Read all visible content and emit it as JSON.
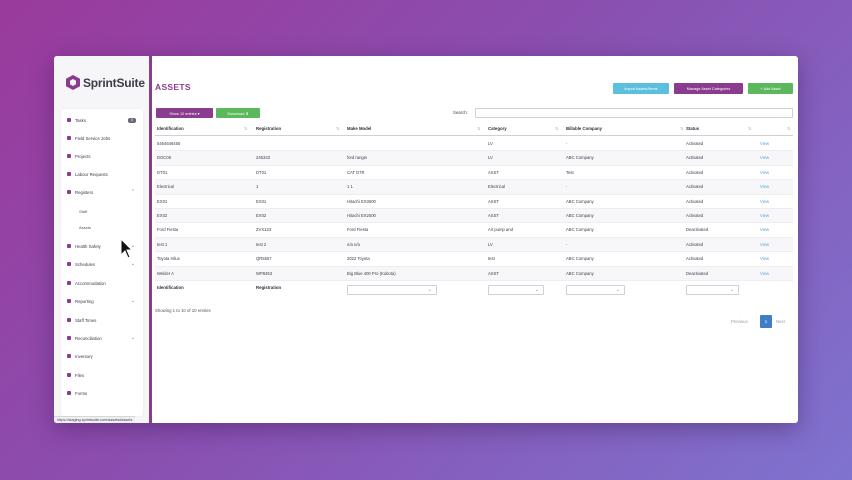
{
  "app": {
    "logo_text": "SprintSuite",
    "page_title": "ASSETS",
    "accent": "#8b3c8f"
  },
  "sidebar": {
    "items": [
      {
        "label": "Tasks",
        "icon": "tasks-icon",
        "badge": "0"
      },
      {
        "label": "Field Service Jobs",
        "icon": "wrench-icon"
      },
      {
        "label": "Projects",
        "icon": "projects-icon"
      },
      {
        "label": "Labour Requests",
        "icon": "person-icon"
      },
      {
        "label": "Registers",
        "icon": "registers-icon",
        "expanded": true
      },
      {
        "label": "Staff",
        "sub": true
      },
      {
        "label": "Assets",
        "sub": true
      },
      {
        "label": "Health Safety",
        "icon": "health-icon"
      },
      {
        "label": "Schedules",
        "icon": "calendar-icon"
      },
      {
        "label": "Accommodation",
        "icon": "bed-icon"
      },
      {
        "label": "Reporting",
        "icon": "chart-icon"
      },
      {
        "label": "Staff Times",
        "icon": "clock-icon"
      },
      {
        "label": "Reconciliation",
        "icon": "reconcile-icon"
      },
      {
        "label": "Inventory",
        "icon": "inventory-icon"
      },
      {
        "label": "Files",
        "icon": "folder-icon"
      },
      {
        "label": "Forms",
        "icon": "form-icon"
      }
    ]
  },
  "status_url": "https://staging.sprintsuite.com/assets#assets",
  "toolbar": {
    "import_label": "Import Assets/Items",
    "categories_label": "Manage Asset Categories",
    "add_label": "+ Add Asset",
    "show_entries_label": "Show 10 entries ▾",
    "download_label": "Download ⬇",
    "search_label": "Search:",
    "search_value": ""
  },
  "table": {
    "columns": [
      "Identification",
      "Registration",
      "Make Model",
      "Category",
      "Billable Company",
      "Status"
    ],
    "rows": [
      [
        "5454646455",
        "",
        "",
        "LV",
        "-",
        "Activated",
        "View"
      ],
      [
        "DOC08",
        "245343",
        "ford ranger",
        "LV",
        "ABC Company",
        "Activated",
        "View"
      ],
      [
        "DT01",
        "DT01",
        "CAT D7R",
        "ASST",
        "Test",
        "Activated",
        "View"
      ],
      [
        "Electrical",
        "1",
        "1 1",
        "Electrical",
        "-",
        "Activated",
        "View"
      ],
      [
        "EX01",
        "EX01",
        "Hitachi EX3600",
        "ASST",
        "ABC Company",
        "Activated",
        "View"
      ],
      [
        "EX02",
        "EX02",
        "Hitachi EX2500",
        "ASST",
        "ABC Company",
        "Activated",
        "View"
      ],
      [
        "Ford Fiesta",
        "ZVX123",
        "Ford Fiesta",
        "Air pump and",
        "ABC Company",
        "Deactivated",
        "View"
      ],
      [
        "test 1",
        "test 2",
        "n/a n/a",
        "LV",
        "-",
        "Activated",
        "View"
      ],
      [
        "Toyota Hilux",
        "QR5567",
        "2022 Toyota",
        "test",
        "ABC Company",
        "Activated",
        "View"
      ],
      [
        "Welder A",
        "WP8453",
        "Big Blue 400 Pro (Kubota)",
        "ASST",
        "ABC Company",
        "Deactivated",
        "View"
      ]
    ],
    "footer_labels": [
      "Identification",
      "Registration"
    ],
    "info": "Showing 1 to 10 of 10 entries"
  },
  "pagination": {
    "prev": "Previous",
    "page": "1",
    "next": "Next"
  }
}
